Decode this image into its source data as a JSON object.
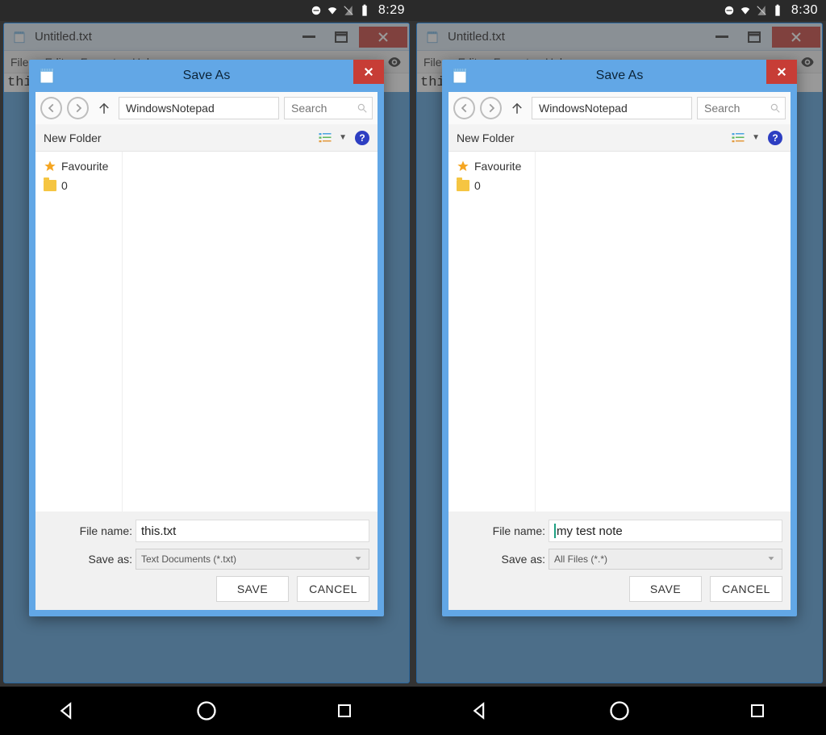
{
  "screens": [
    {
      "status_time": "8:29",
      "window": {
        "title": "Untitled.txt",
        "menus": [
          "File",
          "Edit",
          "Format",
          "Help"
        ],
        "editor_text": "thi"
      },
      "dialog": {
        "title": "Save As",
        "path": "WindowsNotepad",
        "search_placeholder": "Search",
        "new_folder_label": "New Folder",
        "sidebar": [
          {
            "icon": "star",
            "label": "Favourite"
          },
          {
            "icon": "folder",
            "label": "0"
          }
        ],
        "filename_label": "File name:",
        "filename_value": "this.txt",
        "show_cursor": false,
        "saveas_label": "Save as:",
        "saveas_value": "Text Documents (*.txt)",
        "save_btn": "SAVE",
        "cancel_btn": "CANCEL"
      }
    },
    {
      "status_time": "8:30",
      "window": {
        "title": "Untitled.txt",
        "menus": [
          "File",
          "Edit",
          "Format",
          "Help"
        ],
        "editor_text": "thi"
      },
      "dialog": {
        "title": "Save As",
        "path": "WindowsNotepad",
        "search_placeholder": "Search",
        "new_folder_label": "New Folder",
        "sidebar": [
          {
            "icon": "star",
            "label": "Favourite"
          },
          {
            "icon": "folder",
            "label": "0"
          }
        ],
        "filename_label": "File name:",
        "filename_value": "my test note",
        "show_cursor": true,
        "saveas_label": "Save as:",
        "saveas_value": "All Files (*.*)",
        "save_btn": "SAVE",
        "cancel_btn": "CANCEL"
      }
    }
  ]
}
